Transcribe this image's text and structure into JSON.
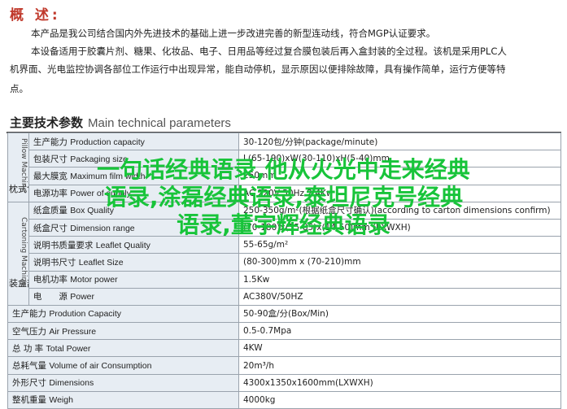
{
  "overview": {
    "title": "概 述:",
    "line1": "本产品是我公司结合国内外先进技术的基础上进一步改进完善的新型连动线，符合MGP认证要求。",
    "line2a": "本设备适用于胶囊片剂、糖果、化妆品、电子、日用品等经过复合膜包装后再入盒封装的全过程。该机是采用PLC人",
    "line2b": "机界面、光电监控协调各部位工作运行中出现异常，能自动停机，显示原因以便排除故障，具有操作简单，运行方便等特",
    "line2c": "点。"
  },
  "section": {
    "title_zh": "主要技术参数",
    "title_en": "Main technical parameters"
  },
  "pillow": {
    "group_zh": "枕式包装部分",
    "group_en": "Pillow Machine",
    "rows": [
      {
        "zh": "生产能力",
        "en": "Production capacity",
        "val": "30-120包/分钟(package/minute)"
      },
      {
        "zh": "包装尺寸",
        "en": "Packaging size",
        "val": "L(65-190)xW(30-110)xH(5-40)mm"
      },
      {
        "zh": "最大膜宽",
        "en": "Maximum film width",
        "val": "250mm"
      },
      {
        "zh": "电源功率",
        "en": "Power of supply",
        "val": "AC 220V 50Hz 2.4Kw"
      }
    ]
  },
  "carton": {
    "group_zh": "装盒部分",
    "group_en": "Cartoning Machine",
    "rows": [
      {
        "zh": "纸盒质量",
        "en": "Box Quality",
        "val": "250-350g/m²(根据纸盒尺寸确认)(according to carton dimensions confirm)"
      },
      {
        "zh": "纸盒尺寸",
        "en": "Dimension range",
        "val": "(70-180)x(35-85)x(14-50)mm (LXWXH)"
      },
      {
        "zh": "说明书质量要求",
        "en": "Leaflet Quality",
        "val": "55-65g/m²"
      },
      {
        "zh": "说明书尺寸",
        "en": "Leaflet Size",
        "val": "(80-300)mm x (70-210)mm"
      },
      {
        "zh": "电机功率",
        "en": "Motor power",
        "val": "1.5Kw"
      },
      {
        "zh": "电　　源",
        "en": "Power",
        "val": "AC380V/50HZ"
      }
    ]
  },
  "general": [
    {
      "zh": "生产能力",
      "en": "Prodution Capacity",
      "val": "50-90盒/分(Box/Min)"
    },
    {
      "zh": "空气压力",
      "en": "Air Pressure",
      "val": "0.5-0.7Mpa"
    },
    {
      "zh": "总 功 率",
      "en": "Total Power",
      "val": "4KW"
    },
    {
      "zh": "总耗气量",
      "en": "Volume of air Consumption",
      "val": "20m³/h"
    },
    {
      "zh": "外形尺寸",
      "en": "Dimensions",
      "val": "4300x1350x1600mm(LXWXH)"
    },
    {
      "zh": "整机重量",
      "en": "Weigh",
      "val": "4000kg"
    }
  ],
  "watermark": {
    "line1": "一句话经典语录,他从火光中走来经典",
    "line2": "语录,涂磊经典语录,泰坦尼克号经典",
    "line3": "语录,董宇辉经典语录"
  },
  "colors": {
    "accent_title": "#c0392b",
    "label_bg": "#e7edf3",
    "border": "#9aa3ad",
    "watermark": "#18c43a"
  }
}
